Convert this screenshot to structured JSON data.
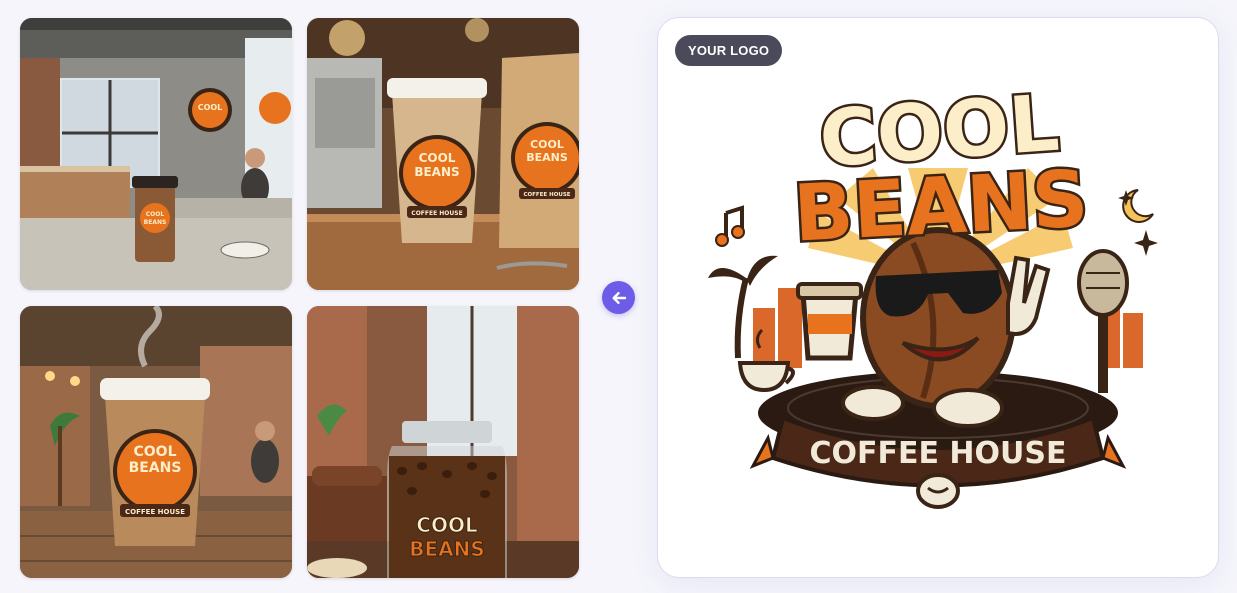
{
  "gallery": {
    "tiles": [
      {
        "scene": "cafe interior with cup on counter",
        "cup_text": [
          "COOL",
          "BEANS"
        ]
      },
      {
        "scene": "takeaway cup and coffee bag",
        "cup_text": [
          "COOL",
          "BEANS",
          "COFFEE HOUSE"
        ],
        "bag_text": [
          "COOL",
          "BEANS",
          "COFFEE HOUSE"
        ]
      },
      {
        "scene": "steaming cup on wooden table",
        "cup_text": [
          "COOL",
          "BEANS",
          "COFFEE HOUSE"
        ]
      },
      {
        "scene": "jar of coffee beans",
        "jar_text": [
          "COOL",
          "BEANS"
        ]
      }
    ]
  },
  "controls": {
    "back_icon": "arrow-left-icon",
    "accent_color": "#6d5ce8"
  },
  "preview": {
    "badge_label": "YOUR LOGO",
    "logo": {
      "line1": "COOL",
      "line2": "BEANS",
      "banner": "COFFEE HOUSE",
      "colors": {
        "orange": "#e8731e",
        "cream": "#fbeec8",
        "teal": "#5fa8a0",
        "brown": "#4a2716",
        "bean": "#8a4a22",
        "sunburst": "#f6c35a"
      }
    }
  }
}
